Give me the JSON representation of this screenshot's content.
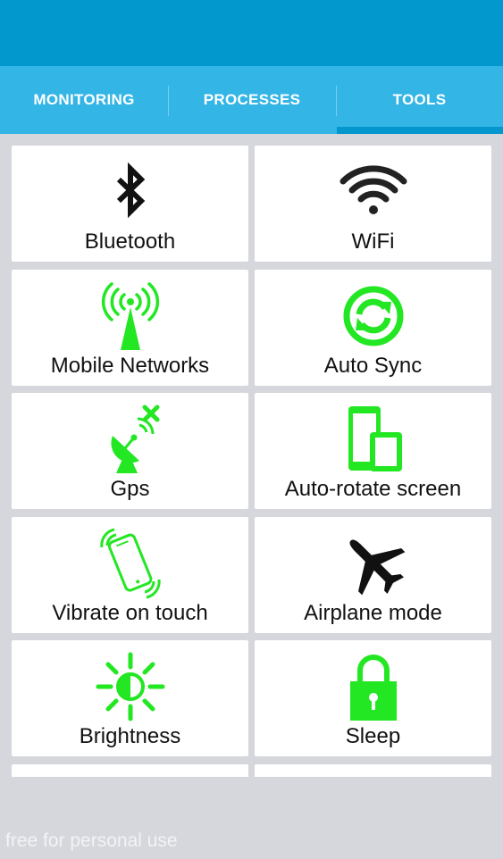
{
  "tabs": [
    {
      "label": "MONITORING",
      "selected": false
    },
    {
      "label": "PROCESSES",
      "selected": false
    },
    {
      "label": "TOOLS",
      "selected": true
    }
  ],
  "colors": {
    "status_bar": "#0398cd",
    "tab_bar": "#33b5e5",
    "tab_indicator": "#0397cd",
    "icon_active": "#22e722",
    "icon_inactive": "#111111",
    "background": "#d5d7dc"
  },
  "tools": [
    {
      "label": "Bluetooth",
      "icon": "bluetooth-icon",
      "state": "off"
    },
    {
      "label": "WiFi",
      "icon": "wifi-icon",
      "state": "off"
    },
    {
      "label": "Mobile Networks",
      "icon": "mobile-networks-icon",
      "state": "on"
    },
    {
      "label": "Auto Sync",
      "icon": "auto-sync-icon",
      "state": "on"
    },
    {
      "label": "Gps",
      "icon": "gps-icon",
      "state": "on"
    },
    {
      "label": "Auto-rotate screen",
      "icon": "auto-rotate-icon",
      "state": "on"
    },
    {
      "label": "Vibrate on touch",
      "icon": "vibrate-icon",
      "state": "on"
    },
    {
      "label": "Airplane mode",
      "icon": "airplane-icon",
      "state": "off"
    },
    {
      "label": "Brightness",
      "icon": "brightness-icon",
      "state": "on"
    },
    {
      "label": "Sleep",
      "icon": "lock-icon",
      "state": "on"
    }
  ],
  "watermark": "free for personal use"
}
